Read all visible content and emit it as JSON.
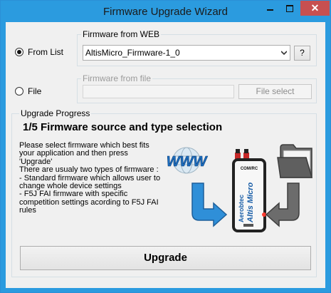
{
  "window": {
    "title": "Firmware Upgrade Wizard",
    "close_glyph": "✕"
  },
  "source": {
    "from_list_label": "From List",
    "from_list_selected": true,
    "web_group_title": "Firmware from WEB",
    "firmware_selected": "AltisMicro_Firmware-1_0",
    "help_button_label": "?",
    "file_label": "File",
    "file_selected": false,
    "file_group_title": "Firmware from file",
    "file_path_value": "",
    "file_select_label": "File select"
  },
  "progress": {
    "group_title": "Upgrade Progress",
    "step_title": "1/5 Firmware source and type selection",
    "description": "Please select firmware which best fits\nyour application and then press\n'Upgrade'\nThere are usualy two types of firmware :\n- Standard firmware which allows user to\nchange whole device settings\n- F5J FAI firmware with specific\ncompetition settings acording to F5J FAI\nrules",
    "www_icon_text": "WWW",
    "device_label_top": "COM/RC",
    "device_brand": "Altis Micro",
    "device_logo": "Aerobtec"
  },
  "upgrade_button_label": "Upgrade",
  "colors": {
    "titlebar": "#2b9bdf",
    "close_button": "#c75050",
    "arrow_blue": "#2f8fd8",
    "folder_gray": "#5f5f5f"
  },
  "icons": [
    "minimize-icon",
    "maximize-icon",
    "close-icon",
    "dropdown-arrow-icon",
    "www-icon",
    "download-arrow-icon",
    "device-icon",
    "folder-icon",
    "file-arrow-icon"
  ]
}
